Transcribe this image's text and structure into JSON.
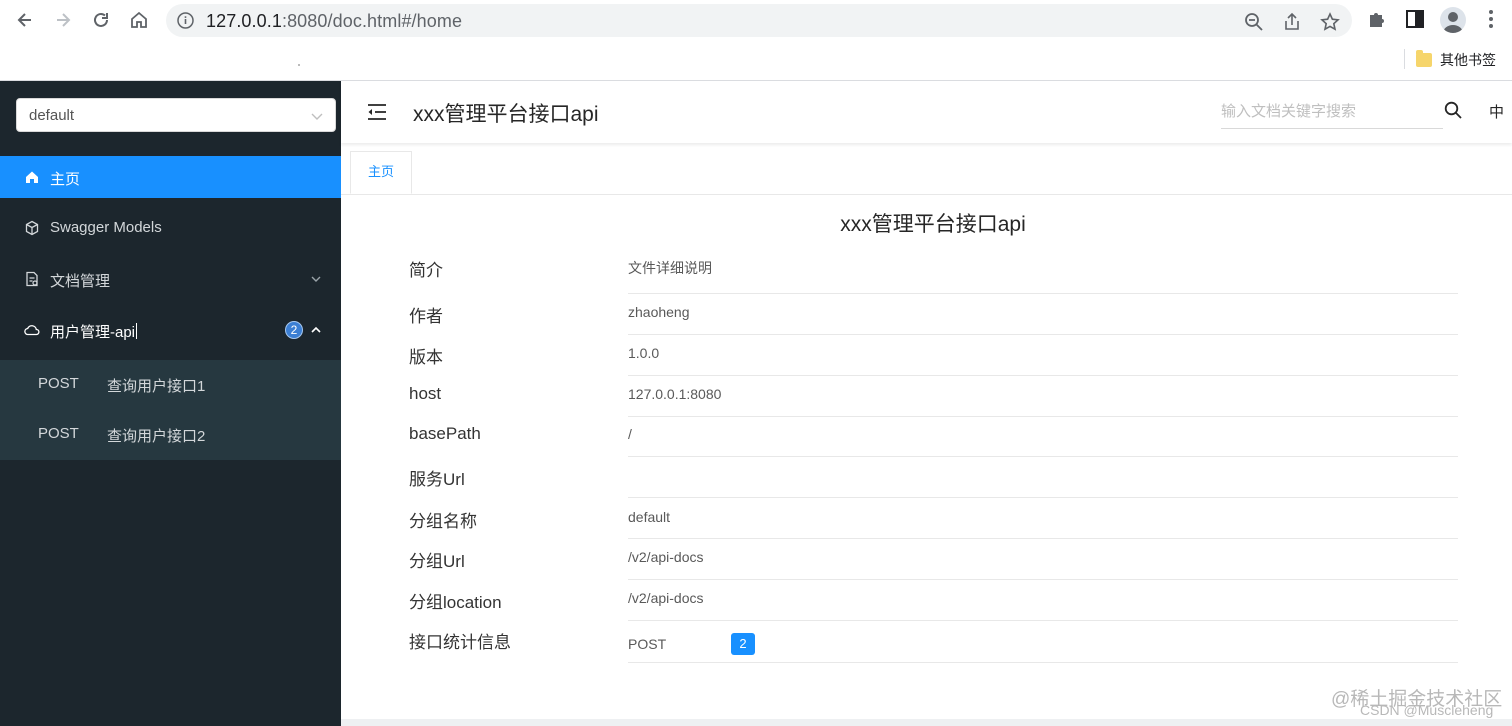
{
  "browser": {
    "url_host": "127.0.0.1",
    "url_port": ":8080",
    "url_path": "/doc.html#/home",
    "bookmark_label": "其他书签"
  },
  "sidebar": {
    "group_select_value": "default",
    "items": [
      {
        "label": "主页",
        "icon": "home-icon",
        "active": true
      },
      {
        "label": "Swagger Models",
        "icon": "cube-icon",
        "active": false
      },
      {
        "label": "文档管理",
        "icon": "document-icon",
        "active": false
      },
      {
        "label": "用户管理-api",
        "icon": "cloud-icon",
        "active": false,
        "badge": "2"
      }
    ],
    "sub_items": [
      {
        "method": "POST",
        "name": "查询用户接口1"
      },
      {
        "method": "POST",
        "name": "查询用户接口2"
      }
    ]
  },
  "header": {
    "title": "xxx管理平台接口api",
    "search_placeholder": "输入文档关键字搜索",
    "lang_label": "中"
  },
  "tabs": [
    {
      "label": "主页",
      "active": true
    }
  ],
  "doc": {
    "title": "xxx管理平台接口api",
    "rows": [
      {
        "label": "简介",
        "value": "文件详细说明"
      },
      {
        "label": "作者",
        "value": "zhaoheng"
      },
      {
        "label": "版本",
        "value": "1.0.0"
      },
      {
        "label": "host",
        "value": "127.0.0.1:8080"
      },
      {
        "label": "basePath",
        "value": "/"
      },
      {
        "label": "服务Url",
        "value": ""
      },
      {
        "label": "分组名称",
        "value": "default"
      },
      {
        "label": "分组Url",
        "value": "/v2/api-docs"
      },
      {
        "label": "分组location",
        "value": "/v2/api-docs"
      },
      {
        "label": "接口统计信息",
        "value": "POST",
        "count": "2"
      }
    ]
  },
  "watermark": {
    "line1": "@稀土掘金技术社区",
    "line2": "CSDN @Muscleheng"
  },
  "colors": {
    "accent": "#1890ff",
    "sidebar_bg": "#1c262d",
    "submenu_bg": "#263840"
  }
}
